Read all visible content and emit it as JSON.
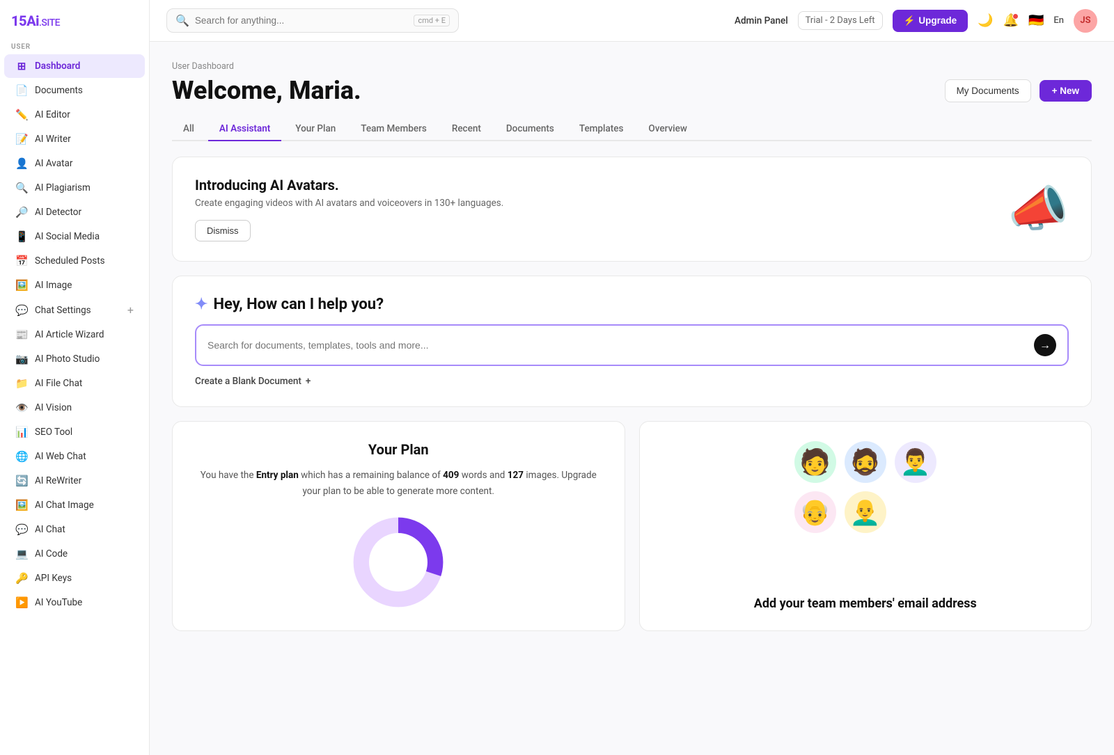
{
  "logo": {
    "text1": "15",
    "text2": "Ai",
    "text3": ".SITE"
  },
  "sidebar": {
    "section_label": "USER",
    "items": [
      {
        "id": "dashboard",
        "label": "Dashboard",
        "icon": "⊞",
        "active": true
      },
      {
        "id": "documents",
        "label": "Documents",
        "icon": "📄"
      },
      {
        "id": "ai-editor",
        "label": "AI Editor",
        "icon": "✏️"
      },
      {
        "id": "ai-writer",
        "label": "AI Writer",
        "icon": "📝"
      },
      {
        "id": "ai-avatar",
        "label": "AI Avatar",
        "icon": "👤"
      },
      {
        "id": "ai-plagiarism",
        "label": "AI Plagiarism",
        "icon": "🔍"
      },
      {
        "id": "ai-detector",
        "label": "AI Detector",
        "icon": "🔎"
      },
      {
        "id": "ai-social-media",
        "label": "AI Social Media",
        "icon": "📱"
      },
      {
        "id": "scheduled-posts",
        "label": "Scheduled Posts",
        "icon": "📅"
      },
      {
        "id": "ai-image",
        "label": "AI Image",
        "icon": "🖼️"
      },
      {
        "id": "chat-settings",
        "label": "Chat Settings",
        "icon": "💬",
        "has_plus": true
      },
      {
        "id": "ai-article-wizard",
        "label": "AI Article Wizard",
        "icon": "📰"
      },
      {
        "id": "ai-photo-studio",
        "label": "AI Photo Studio",
        "icon": "📷"
      },
      {
        "id": "ai-file-chat",
        "label": "AI File Chat",
        "icon": "📁"
      },
      {
        "id": "ai-vision",
        "label": "AI Vision",
        "icon": "👁️"
      },
      {
        "id": "seo-tool",
        "label": "SEO Tool",
        "icon": "📊"
      },
      {
        "id": "ai-web-chat",
        "label": "AI Web Chat",
        "icon": "🌐"
      },
      {
        "id": "ai-rewriter",
        "label": "AI ReWriter",
        "icon": "🔄"
      },
      {
        "id": "ai-chat-image",
        "label": "AI Chat Image",
        "icon": "🖼️"
      },
      {
        "id": "ai-chat",
        "label": "AI Chat",
        "icon": "💬"
      },
      {
        "id": "ai-code",
        "label": "AI Code",
        "icon": "💻"
      },
      {
        "id": "api-keys",
        "label": "API Keys",
        "icon": "🔑"
      },
      {
        "id": "ai-youtube",
        "label": "AI YouTube",
        "icon": "▶️"
      }
    ]
  },
  "topnav": {
    "search_placeholder": "Search for anything...",
    "search_shortcut": "cmd + E",
    "admin_label": "Admin Panel",
    "trial_label": "Trial - 2 Days Left",
    "upgrade_label": "Upgrade",
    "lang": "En",
    "user_initials": "JS"
  },
  "content": {
    "breadcrumb": "User Dashboard",
    "welcome_title": "Welcome, Maria.",
    "my_docs_label": "My Documents",
    "new_label": "+ New",
    "tabs": [
      {
        "id": "all",
        "label": "All"
      },
      {
        "id": "ai-assistant",
        "label": "AI Assistant",
        "active": true
      },
      {
        "id": "your-plan",
        "label": "Your Plan"
      },
      {
        "id": "team-members",
        "label": "Team Members"
      },
      {
        "id": "recent",
        "label": "Recent"
      },
      {
        "id": "documents",
        "label": "Documents"
      },
      {
        "id": "templates",
        "label": "Templates"
      },
      {
        "id": "overview",
        "label": "Overview"
      }
    ],
    "banner": {
      "title": "Introducing AI Avatars.",
      "description": "Create engaging videos with AI avatars and voiceovers in 130+ languages.",
      "dismiss_label": "Dismiss",
      "icon": "📣"
    },
    "ai_help": {
      "title": "Hey, How can I help you?",
      "search_placeholder": "Search for documents, templates, tools and more...",
      "create_blank_label": "Create a Blank Document"
    },
    "plan": {
      "title": "Your Plan",
      "description_prefix": "You have the ",
      "plan_name": "Entry plan",
      "description_mid": " which has a remaining balance of ",
      "words": "409",
      "words_label": "words",
      "images": "127",
      "images_label": "images",
      "description_suffix": ". Upgrade your plan to be able to generate more content.",
      "donut_used_pct": 30,
      "donut_color_used": "#7c3aed",
      "donut_color_remaining": "#e9d5ff"
    },
    "team": {
      "title": "Add your team members' email address",
      "avatars": [
        "🧑",
        "🧔",
        "👨‍🦱",
        "👨‍🦲",
        "👴"
      ]
    }
  }
}
